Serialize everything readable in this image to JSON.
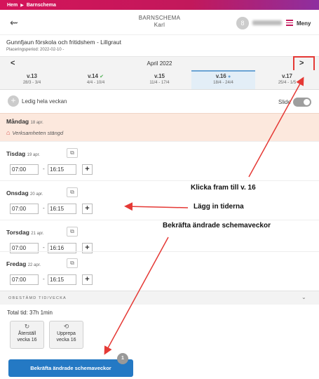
{
  "breadcrumb": {
    "home": "Hem",
    "current": "Barnschema"
  },
  "header": {
    "title": "BARNSCHEMA",
    "child_name": "Karl",
    "avatar_letter": "8",
    "menu_label": "Meny"
  },
  "school": {
    "name": "Gunnfjaun förskola och fritidshem - Lillgraut",
    "period": "Placeringsperiod: 2022-02-10 -"
  },
  "calendar": {
    "month": "April 2022",
    "weeks": [
      {
        "label": "v.13",
        "range": "28/3 - 3/4"
      },
      {
        "label": "v.14",
        "range": "4/4 - 10/4"
      },
      {
        "label": "v.15",
        "range": "11/4 - 17/4"
      },
      {
        "label": "v.16",
        "range": "18/4 - 24/4"
      },
      {
        "label": "v.17",
        "range": "25/4 - 1/5"
      }
    ]
  },
  "toolbar": {
    "free_week": "Ledig hela veckan",
    "slide_label": "Slide"
  },
  "days": {
    "monday": {
      "name": "Måndag",
      "date": "18 apr.",
      "notice": "Verksamheten stängd"
    },
    "tuesday": {
      "name": "Tisdag",
      "date": "19 apr.",
      "from": "07:00",
      "to": "16:15"
    },
    "wednesday": {
      "name": "Onsdag",
      "date": "20 apr.",
      "from": "07:00",
      "to": "16:15"
    },
    "thursday": {
      "name": "Torsdag",
      "date": "21 apr.",
      "from": "07:00",
      "to": "16:16"
    },
    "friday": {
      "name": "Fredag",
      "date": "22 apr.",
      "from": "07:00",
      "to": "16:15"
    }
  },
  "unspecified": {
    "label": "OBESTÄMD TID/VECKA"
  },
  "total": "Total tid: 37h 1min",
  "actions": {
    "reset_line1": "Återställ",
    "reset_line2": "vecka 16",
    "repeat_line1": "Upprepa",
    "repeat_line2": "vecka 16"
  },
  "confirm": {
    "label": "Bekräfta ändrade schemaveckor",
    "badge": "1"
  },
  "annotations": {
    "step1": "Klicka fram till v. 16",
    "step2": "Lägg in tiderna",
    "step3": "Bekräfta ändrade schemaveckor"
  },
  "colors": {
    "brand": "#c2185b",
    "primary": "#2479c4",
    "annotation_red": "#e53935",
    "closed_bg": "#fce8dd"
  }
}
